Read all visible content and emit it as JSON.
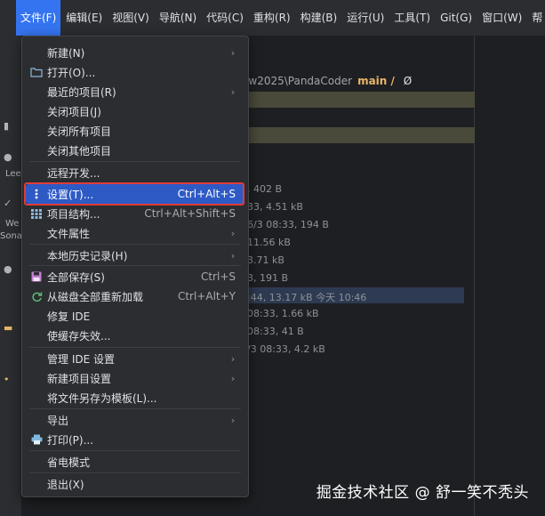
{
  "menubar": {
    "items": [
      "文件(F)",
      "编辑(E)",
      "视图(V)",
      "导航(N)",
      "代码(C)",
      "重构(R)",
      "构建(B)",
      "运行(U)",
      "工具(T)",
      "Git(G)",
      "窗口(W)",
      "帮"
    ]
  },
  "left_strip": {
    "labels": [
      "Lee",
      "We",
      "Sona"
    ]
  },
  "editor": {
    "path": "ew2025\\PandaCoder",
    "branch": "main /",
    "branch_icon": "Ø",
    "file_infos": [
      ", 402 B",
      "33, 4.51 kB",
      "6/3 08:33, 194 B",
      "11.56 kB",
      "3.71 kB",
      "3, 191 B",
      ":44, 13.17 kB 今天 10:46",
      "08:33, 1.66 kB",
      "08:33, 41 B",
      "/3 08:33, 4.2 kB"
    ],
    "watermark": "掘金技术社区 @ 舒一笑不秃头"
  },
  "dropdown": {
    "items": [
      {
        "label": "新建(N)",
        "submenu": true
      },
      {
        "label": "打开(O)...",
        "icon": "folder-icon"
      },
      {
        "label": "最近的项目(R)",
        "submenu": true
      },
      {
        "label": "关闭项目(J)"
      },
      {
        "label": "关闭所有项目"
      },
      {
        "label": "关闭其他项目"
      },
      {
        "label": "远程开发..."
      },
      {
        "label": "设置(T)...",
        "shortcut": "Ctrl+Alt+S",
        "icon": "settings-icon"
      },
      {
        "label": "项目结构...",
        "shortcut": "Ctrl+Alt+Shift+S",
        "icon": "project-structure-icon"
      },
      {
        "label": "文件属性",
        "submenu": true
      },
      {
        "label": "本地历史记录(H)",
        "submenu": true
      },
      {
        "label": "全部保存(S)",
        "shortcut": "Ctrl+S",
        "icon": "save-icon"
      },
      {
        "label": "从磁盘全部重新加载",
        "shortcut": "Ctrl+Alt+Y",
        "icon": "reload-icon"
      },
      {
        "label": "修复 IDE"
      },
      {
        "label": "使缓存失效..."
      },
      {
        "label": "管理 IDE 设置",
        "submenu": true
      },
      {
        "label": "新建项目设置",
        "submenu": true
      },
      {
        "label": "将文件另存为模板(L)..."
      },
      {
        "label": "导出",
        "submenu": true
      },
      {
        "label": "打印(P)...",
        "icon": "print-icon"
      },
      {
        "label": "省电模式"
      },
      {
        "label": "退出(X)"
      }
    ]
  },
  "colors": {
    "accent": "#3574f0",
    "highlight": "#2e5ac6",
    "red_outline": "#e03b3b"
  }
}
